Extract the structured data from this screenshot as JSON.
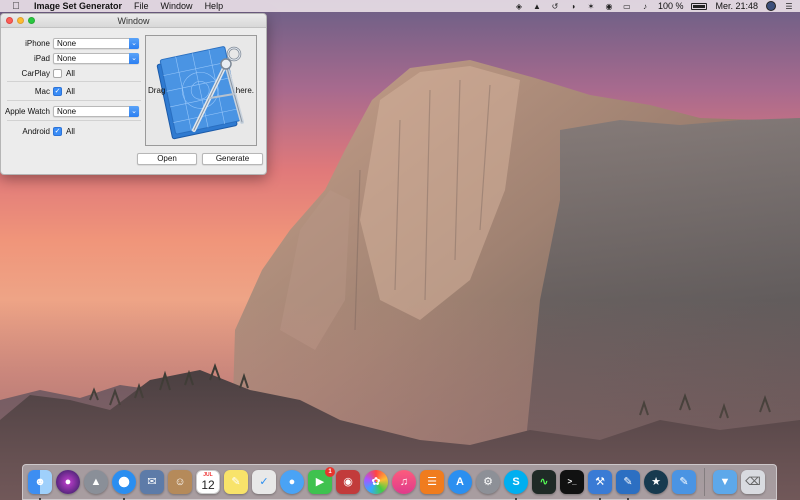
{
  "menubar": {
    "apple_icon": "apple-logo-icon",
    "app_name": "Image Set Generator",
    "menus": [
      "File",
      "Window",
      "Help"
    ],
    "battery_percent": "100 %",
    "clock": "Mer. 21:48"
  },
  "window": {
    "title": "Window",
    "rows": {
      "iphone": {
        "label": "iPhone",
        "value": "None"
      },
      "ipad": {
        "label": "iPad",
        "value": "None"
      },
      "carplay": {
        "label": "CarPlay",
        "check_label": "All",
        "checked": false
      },
      "mac": {
        "label": "Mac",
        "check_label": "All",
        "checked": true
      },
      "applewatch": {
        "label": "Apple Watch",
        "value": "None"
      },
      "android": {
        "label": "Android",
        "check_label": "All",
        "checked": true
      }
    },
    "dropzone": {
      "hint_left": "Drag",
      "hint_right": "here."
    },
    "buttons": {
      "open": "Open",
      "generate": "Generate"
    }
  },
  "dock": {
    "calendar_month": "JUL",
    "calendar_day": "12",
    "facetime_badge": "1"
  },
  "colors": {
    "accent": "#3b8df6",
    "close": "#fc5f57",
    "minimize": "#fdbc2e",
    "zoom": "#28c840"
  }
}
